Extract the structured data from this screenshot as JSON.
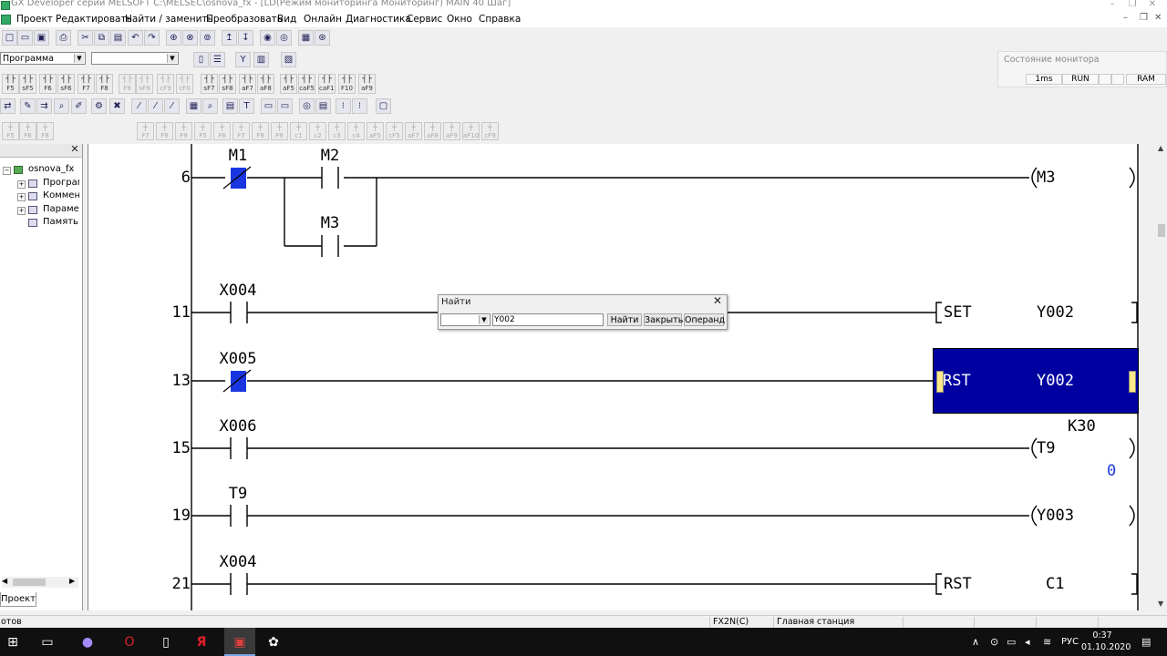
{
  "window": {
    "title": "GX Developer серии MELSOFT C:\\MELSEC\\osnova_fx - [LD(Режим мониторинга Мониторинг)    MAIN    40 Шаг]",
    "min_glyph": "–",
    "max_glyph": "❐",
    "close_glyph": "✕"
  },
  "menu": [
    "Проект",
    "Редактировать",
    "Найти / заменить",
    "Преобразовать",
    "Вид",
    "Онлайн",
    "Диагностика",
    "Сервис",
    "Окно",
    "Справка"
  ],
  "toolbar": {
    "program_select": "Программа",
    "second_select": "",
    "fkeys_row1": [
      "F5",
      "sF5",
      "F6",
      "sF6",
      "F7",
      "F8",
      "F9",
      "sF9",
      "cF9",
      "cF0",
      "sF7",
      "sF8",
      "aF7",
      "aF8",
      "aF5",
      "caF5",
      "caF10",
      "F10",
      "aF9"
    ],
    "fkeys_row4": [
      "F5",
      "F6",
      "F8",
      "F7",
      "F8",
      "F9",
      "F5",
      "F6",
      "F7",
      "F8",
      "F9",
      "c1",
      "c2",
      "c3",
      "c4",
      "aF5",
      "cF5",
      "aF7",
      "aF8",
      "aF9",
      "aF10",
      "cF9"
    ]
  },
  "monitor": {
    "title": "Состояние монитора",
    "scan_time": "1ms",
    "run_state": "RUN",
    "memory": "RAM"
  },
  "project_tree": {
    "root": "osnova_fx",
    "items": [
      "Програм",
      "Коммен",
      "Парамет",
      "Память"
    ],
    "tab": "Проект",
    "close_glyph": "✕"
  },
  "ladder": {
    "rungs": [
      {
        "step": "6",
        "contact": "M1",
        "parallel_a": "M2",
        "parallel_b": "M3",
        "output": "M3"
      },
      {
        "step": "11",
        "contact": "X004",
        "instr": "SET",
        "operand": "Y002"
      },
      {
        "step": "13",
        "contact": "X005",
        "instr": "RST",
        "operand": "Y002"
      },
      {
        "step": "15",
        "contact": "X006",
        "output": "T9",
        "setting": "K30",
        "current": "0"
      },
      {
        "step": "19",
        "contact": "T9",
        "output": "Y003"
      },
      {
        "step": "21",
        "contact": "X004",
        "instr": "RST",
        "operand": "C1"
      }
    ]
  },
  "find_dialog": {
    "title": "Найти",
    "value": "Y002",
    "find_btn": "Найти",
    "close_btn": "Закрыть",
    "operand_btn": "Операнд",
    "close_glyph": "✕"
  },
  "status": {
    "left": "отов",
    "cpu": "FX2N(C)",
    "station": "Главная станция"
  },
  "taskbar": {
    "lang": "РУС",
    "time": "0:37",
    "date": "01.10.2020"
  }
}
